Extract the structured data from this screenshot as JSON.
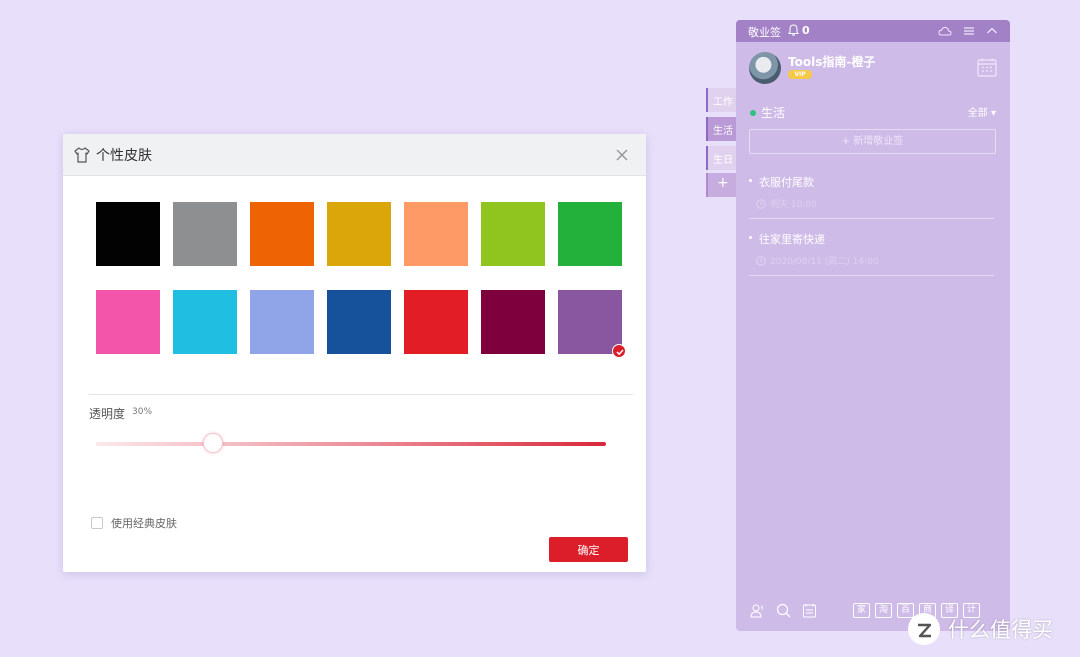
{
  "dialog": {
    "title": "个性皮肤",
    "swatches": [
      {
        "color": "#020203",
        "selected": false
      },
      {
        "color": "#8e8f91",
        "selected": false
      },
      {
        "color": "#ee6303",
        "selected": false
      },
      {
        "color": "#dba60a",
        "selected": false
      },
      {
        "color": "#fd9a66",
        "selected": false
      },
      {
        "color": "#90c51f",
        "selected": false
      },
      {
        "color": "#24b13b",
        "selected": false
      },
      {
        "color": "#f255a9",
        "selected": false
      },
      {
        "color": "#20bee0",
        "selected": false
      },
      {
        "color": "#90a5e8",
        "selected": false
      },
      {
        "color": "#16519c",
        "selected": false
      },
      {
        "color": "#e31d25",
        "selected": false
      },
      {
        "color": "#7e003c",
        "selected": false
      },
      {
        "color": "#8957a0",
        "selected": true
      }
    ],
    "opacity_label": "透明度",
    "opacity_value": "30%",
    "opacity_fraction": 0.23,
    "classic_skin_label": "使用经典皮肤",
    "classic_skin_checked": false,
    "confirm_label": "确定"
  },
  "side_tabs": [
    {
      "label": "工作",
      "active": false
    },
    {
      "label": "生活",
      "active": true
    },
    {
      "label": "生日",
      "active": false
    },
    {
      "label": "+",
      "active": false
    }
  ],
  "panel": {
    "app_name": "敬业签",
    "notification_count": "0",
    "user_name": "Tools指南-橙子",
    "vip_badge": "VIP",
    "category": "生活",
    "filter": "全部 ▾",
    "new_note": "+ 新增敬业签",
    "notes": [
      {
        "title": "衣服付尾款",
        "time": "明天 10:00"
      },
      {
        "title": "往家里寄快递",
        "time": "2020/08/11 (周二) 14:00"
      }
    ],
    "bottom_chars": [
      "家",
      "淘",
      "百",
      "商",
      "译",
      "计"
    ]
  },
  "watermark": {
    "text": "什么值得买"
  }
}
